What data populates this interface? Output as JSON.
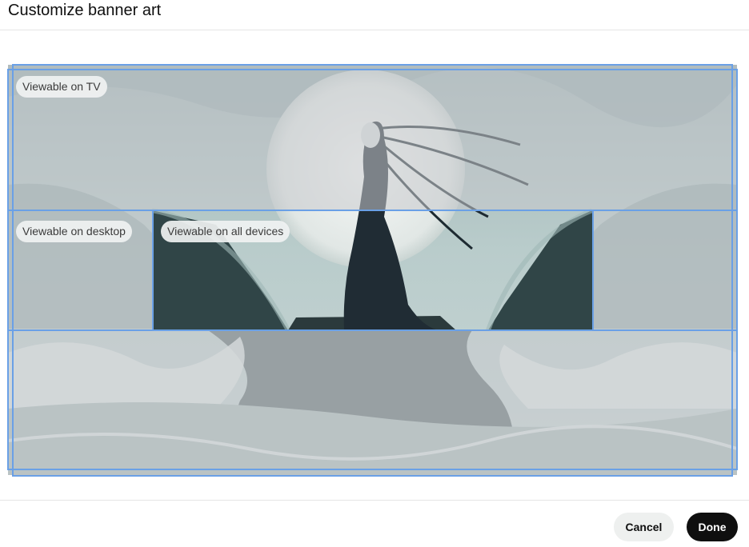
{
  "dialog": {
    "title": "Customize banner art"
  },
  "regions": {
    "tv_label": "Viewable on TV",
    "desktop_label": "Viewable on desktop",
    "all_devices_label": "Viewable on all devices"
  },
  "footer": {
    "cancel_label": "Cancel",
    "done_label": "Done"
  },
  "colors": {
    "guide": "#6aa0e6",
    "done_bg": "#0f0f0f",
    "cancel_bg": "#eef0ef"
  }
}
